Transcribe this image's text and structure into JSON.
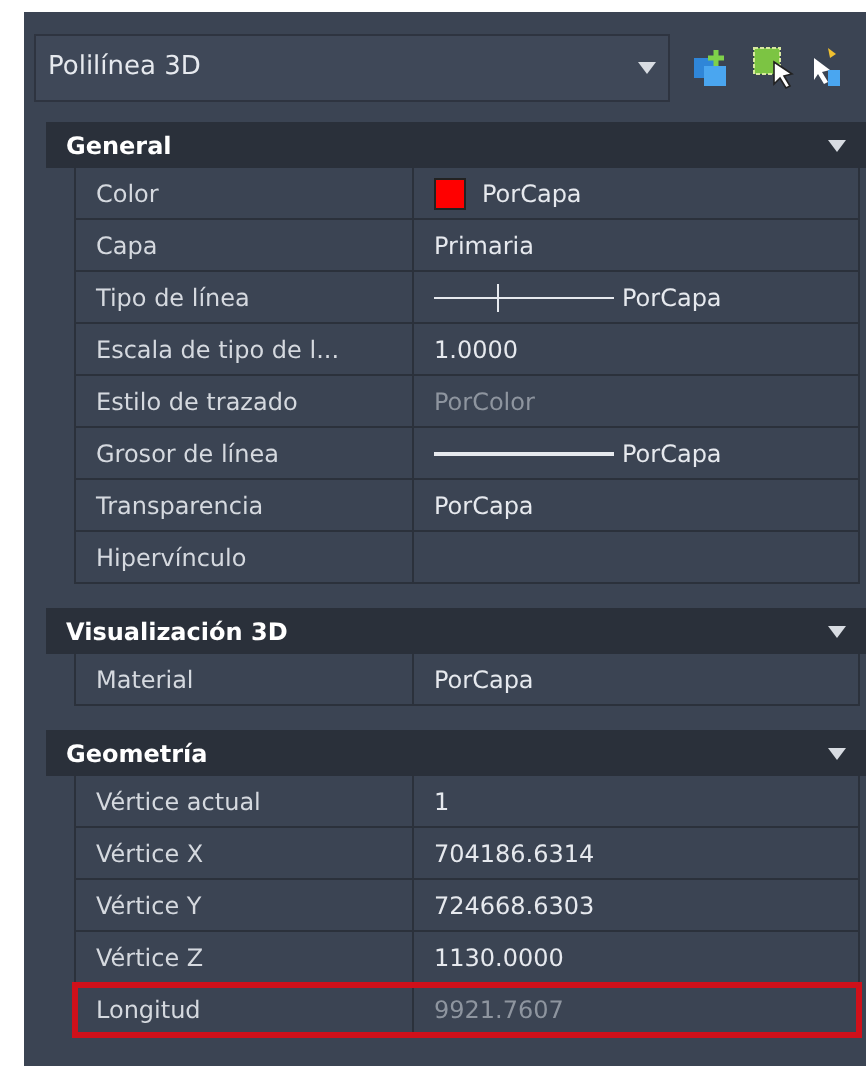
{
  "object_selector": {
    "value": "Polilínea 3D"
  },
  "sections": [
    {
      "title": "General",
      "expanded": true,
      "rows": [
        {
          "label": "Color",
          "value": "PorCapa",
          "kind": "color",
          "color": "#ff0000",
          "disabled": false,
          "highlighted": false
        },
        {
          "label": "Capa",
          "value": "Primaria",
          "kind": "text",
          "disabled": false,
          "highlighted": false
        },
        {
          "label": "Tipo de línea",
          "value": "PorCapa",
          "kind": "linetype",
          "disabled": false,
          "highlighted": false
        },
        {
          "label": "Escala de tipo de l...",
          "value": "1.0000",
          "kind": "text",
          "disabled": false,
          "highlighted": false
        },
        {
          "label": "Estilo de trazado",
          "value": "PorColor",
          "kind": "text",
          "disabled": true,
          "highlighted": false
        },
        {
          "label": "Grosor de línea",
          "value": "PorCapa",
          "kind": "lineweight",
          "disabled": false,
          "highlighted": false
        },
        {
          "label": "Transparencia",
          "value": "PorCapa",
          "kind": "text",
          "disabled": false,
          "highlighted": false
        },
        {
          "label": "Hipervínculo",
          "kind": "text",
          "disabled": false,
          "highlighted": false
        }
      ]
    },
    {
      "title": "Visualización 3D",
      "expanded": true,
      "rows": [
        {
          "label": "Material",
          "value": "PorCapa",
          "kind": "text",
          "disabled": false,
          "highlighted": false
        }
      ]
    },
    {
      "title": "Geometría",
      "expanded": true,
      "rows": [
        {
          "label": "Vértice actual",
          "value": "1",
          "kind": "text",
          "disabled": false,
          "highlighted": false
        },
        {
          "label": "Vértice X",
          "value": "704186.6314",
          "kind": "text",
          "disabled": false,
          "highlighted": false
        },
        {
          "label": "Vértice Y",
          "value": "724668.6303",
          "kind": "text",
          "disabled": false,
          "highlighted": false
        },
        {
          "label": "Vértice Z",
          "value": "1130.0000",
          "kind": "text",
          "disabled": false,
          "highlighted": false
        },
        {
          "label": "Longitud",
          "value": "9921.7607",
          "kind": "text",
          "disabled": true,
          "highlighted": true
        }
      ]
    }
  ]
}
